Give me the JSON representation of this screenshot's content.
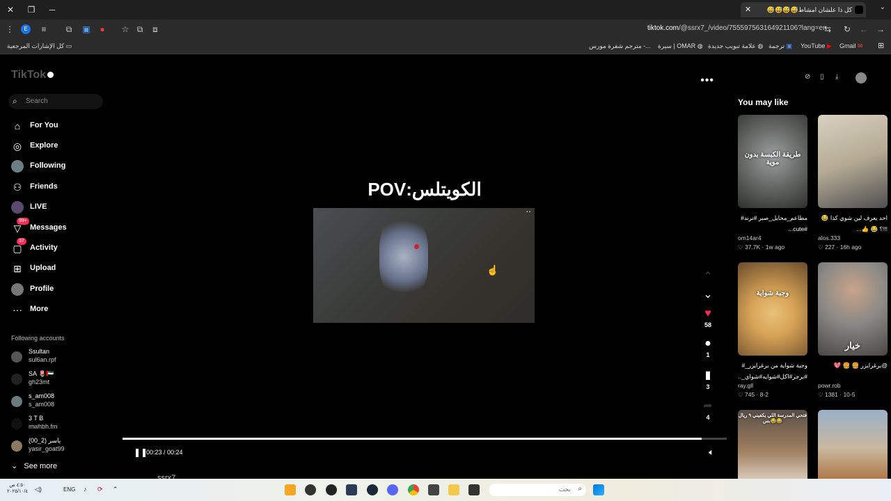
{
  "browser": {
    "tab_title": "كل ذا علشان امشاط😅😅😅😅",
    "new_tab": "+",
    "url_host": "tiktok.com",
    "url_path": "/@ssrx7_/video/7555975631649211​06?lang=en",
    "bookmarks": [
      {
        "label": "كل الإشارات المرجعية"
      },
      {
        "label": "Gmail"
      },
      {
        "label": "YouTube"
      },
      {
        "label": "ترجمة"
      },
      {
        "label": "علامة تبويب جديدة"
      },
      {
        "label": "سيرة | OMAR"
      },
      {
        "label": "مترجم شفرة مورس -..."
      }
    ]
  },
  "sidebar": {
    "logo": "TikTok",
    "search_placeholder": "Search",
    "nav": [
      {
        "label": "For You",
        "icon": "home-icon"
      },
      {
        "label": "Explore",
        "icon": "compass-icon"
      },
      {
        "label": "Following",
        "icon": "avatar-icon"
      },
      {
        "label": "Friends",
        "icon": "friends-icon"
      },
      {
        "label": "LIVE",
        "icon": "live-icon"
      },
      {
        "label": "Messages",
        "icon": "messages-icon",
        "badge": "99+"
      },
      {
        "label": "Activity",
        "icon": "activity-icon",
        "badge": "37"
      },
      {
        "label": "Upload",
        "icon": "upload-icon"
      },
      {
        "label": "Profile",
        "icon": "profile-icon"
      },
      {
        "label": "More",
        "icon": "more-icon"
      }
    ],
    "following_title": "Following accounts",
    "accounts": [
      {
        "name": "Ssultan",
        "handle": "sul6an.rpf"
      },
      {
        "name": "SA 🌷🇦🇪",
        "handle": "gh23mt"
      },
      {
        "name": "s_am008",
        "handle": "s_am008"
      },
      {
        "name": "3 T B",
        "handle": "mwhbh.fm"
      },
      {
        "name": "ياسر (2_00)",
        "handle": "yasir_goat99"
      }
    ],
    "see_more": "See more"
  },
  "video": {
    "overlay_title": "الكويتلس:POV",
    "likes": "58",
    "comments": "1",
    "saves": "3",
    "shares": "4",
    "time": "00:23 / 00:24",
    "progress": 0.958,
    "creator_peek": "ssrx7"
  },
  "recommendations": {
    "title": "You may like",
    "cards": [
      {
        "caption": "مطاعم_محايل_صبر #ترند# #cute...",
        "author": "om14ar4",
        "stats": "♡ 37.7K · 1w ago",
        "overlay": "طريقة الكبسة بدون موية",
        "color1": "#6f7270",
        "color2": "#2e2f2b"
      },
      {
        "caption": "احد يعرف لين شوي كذا 😂 !!!؟ 😂 👍...",
        "author": "alos.333",
        "stats": "♡ 227 · 16h ago",
        "overlay": "",
        "color1": "#c9c0ad",
        "color2": "#5b5b5b"
      },
      {
        "caption": "وجبة شواية من برغرايزر_# #برجر#اكل#شوايه#شواي_...",
        "author": "ray.gll",
        "stats": "♡ 745 · 8-2",
        "overlay": "وجبة شواية",
        "color1": "#d8a457",
        "color2": "#6a4b2c"
      },
      {
        "caption": "@برغرايزر 🍔 🍔 💖",
        "author": "powr.rob",
        "stats": "♡ 1381 · 10-5",
        "overlay": "خيار",
        "color1": "#8a8985",
        "color2": "#4a4743"
      },
      {
        "caption": "",
        "author": "",
        "stats": "",
        "overlay": "فتحي المدرسة اللي يكفيني ٩ ريال بس😂😂",
        "color1": "#7a6a5a",
        "color2": "#a08060"
      },
      {
        "caption": "",
        "author": "",
        "stats": "",
        "overlay": "",
        "color1": "#9ab0c8",
        "color2": "#b07a4a"
      }
    ]
  },
  "taskbar": {
    "search_placeholder": "بحث",
    "lang": "ENG",
    "time": "٤:٥٠ ص",
    "date": "٢٠٢٥/١٠/٤"
  }
}
